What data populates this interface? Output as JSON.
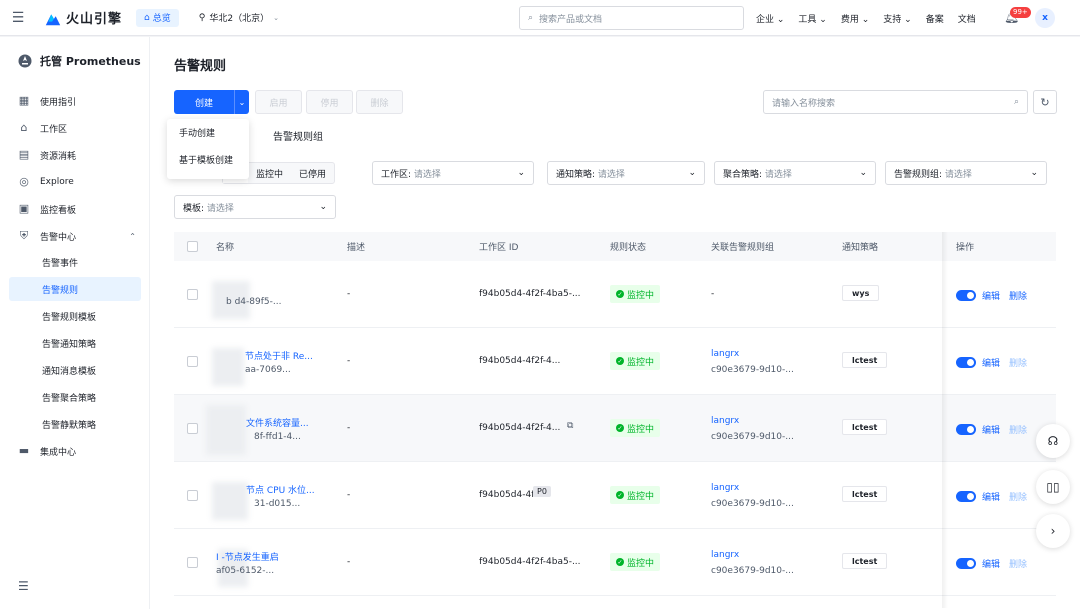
{
  "topbar": {
    "logo_text": "火山引擎",
    "overview": "总览",
    "region": "华北2（北京）",
    "search_placeholder": "搜索产品或文档",
    "nav": [
      "企业",
      "工具",
      "费用",
      "支持",
      "备案",
      "文档"
    ],
    "badge": "99+",
    "avatar": "x"
  },
  "sidebar": {
    "title": "托管 Prometheus",
    "items": [
      {
        "label": "使用指引",
        "icon": "guide-icon"
      },
      {
        "label": "工作区",
        "icon": "home-icon"
      },
      {
        "label": "资源消耗",
        "icon": "resource-icon"
      },
      {
        "label": "Explore",
        "icon": "explore-icon"
      },
      {
        "label": "监控看板",
        "icon": "dashboard-icon"
      },
      {
        "label": "告警中心",
        "icon": "shield-icon"
      }
    ],
    "sub_items": [
      "告警事件",
      "告警规则",
      "告警规则模板",
      "告警通知策略",
      "通知消息模板",
      "告警聚合策略",
      "告警静默策略"
    ],
    "last_item": "集成中心"
  },
  "main": {
    "title": "告警规则",
    "create": "创建",
    "enable": "启用",
    "disable": "停用",
    "delete": "删除",
    "search_placeholder": "请输入名称搜索",
    "dropdown": [
      "手动创建",
      "基于模板创建"
    ],
    "tab_group": "告警规则组",
    "seg": [
      "部",
      "监控中",
      "已停用"
    ],
    "filters": [
      {
        "label": "工作区:",
        "placeholder": "请选择"
      },
      {
        "label": "通知策略:",
        "placeholder": "请选择"
      },
      {
        "label": "聚合策略:",
        "placeholder": "请选择"
      },
      {
        "label": "告警规则组:",
        "placeholder": "请选择"
      },
      {
        "label": "模板:",
        "placeholder": "请选择"
      }
    ]
  },
  "table": {
    "columns": [
      "名称",
      "描述",
      "工作区 ID",
      "规则状态",
      "关联告警规则组",
      "通知策略",
      "操作"
    ],
    "rows": [
      {
        "name": "",
        "sub": "b   d4-89f5-...",
        "desc": "-",
        "ws": "f94b05d4-4f2f-4ba5-...",
        "status": "监控中",
        "group": "-",
        "group_id": "",
        "policy": "wys",
        "edit": "编辑",
        "del": "删除"
      },
      {
        "name": "节点处于非 Re...",
        "sub": "aa-7069...",
        "desc": "-",
        "ws": "f94b05d4-4f2f-4...",
        "status": "监控中",
        "group": "langrx",
        "group_id": "c90e3679-9d10-...",
        "policy": "lctest",
        "edit": "编辑",
        "del": "删除"
      },
      {
        "name": "文件系统容量...",
        "sub": "8f-ffd1-4...",
        "desc": "-",
        "ws": "f94b05d4-4f2f-4...",
        "status": "监控中",
        "group": "langrx",
        "group_id": "c90e3679-9d10-...",
        "policy": "lctest",
        "edit": "编辑",
        "del": "删除"
      },
      {
        "name": "节点 CPU 水位...",
        "sub": "31-d015...",
        "desc": "-",
        "ws": "f94b05d4-4f2",
        "status": "监控中",
        "group": "langrx",
        "group_id": "c90e3679-9d10-...",
        "policy": "lctest",
        "edit": "编辑",
        "del": "删除"
      },
      {
        "name": "I   -节点发生重启",
        "sub": "af05-6152-...",
        "desc": "-",
        "ws": "f94b05d4-4f2f-4ba5-...",
        "status": "监控中",
        "group": "langrx",
        "group_id": "c90e3679-9d10-...",
        "policy": "lctest",
        "edit": "编辑",
        "del": "删除"
      }
    ],
    "tooltip": "P0"
  },
  "colors": {
    "accent": "#1664ff",
    "success": "#00b42a",
    "danger": "#f53f3f"
  }
}
